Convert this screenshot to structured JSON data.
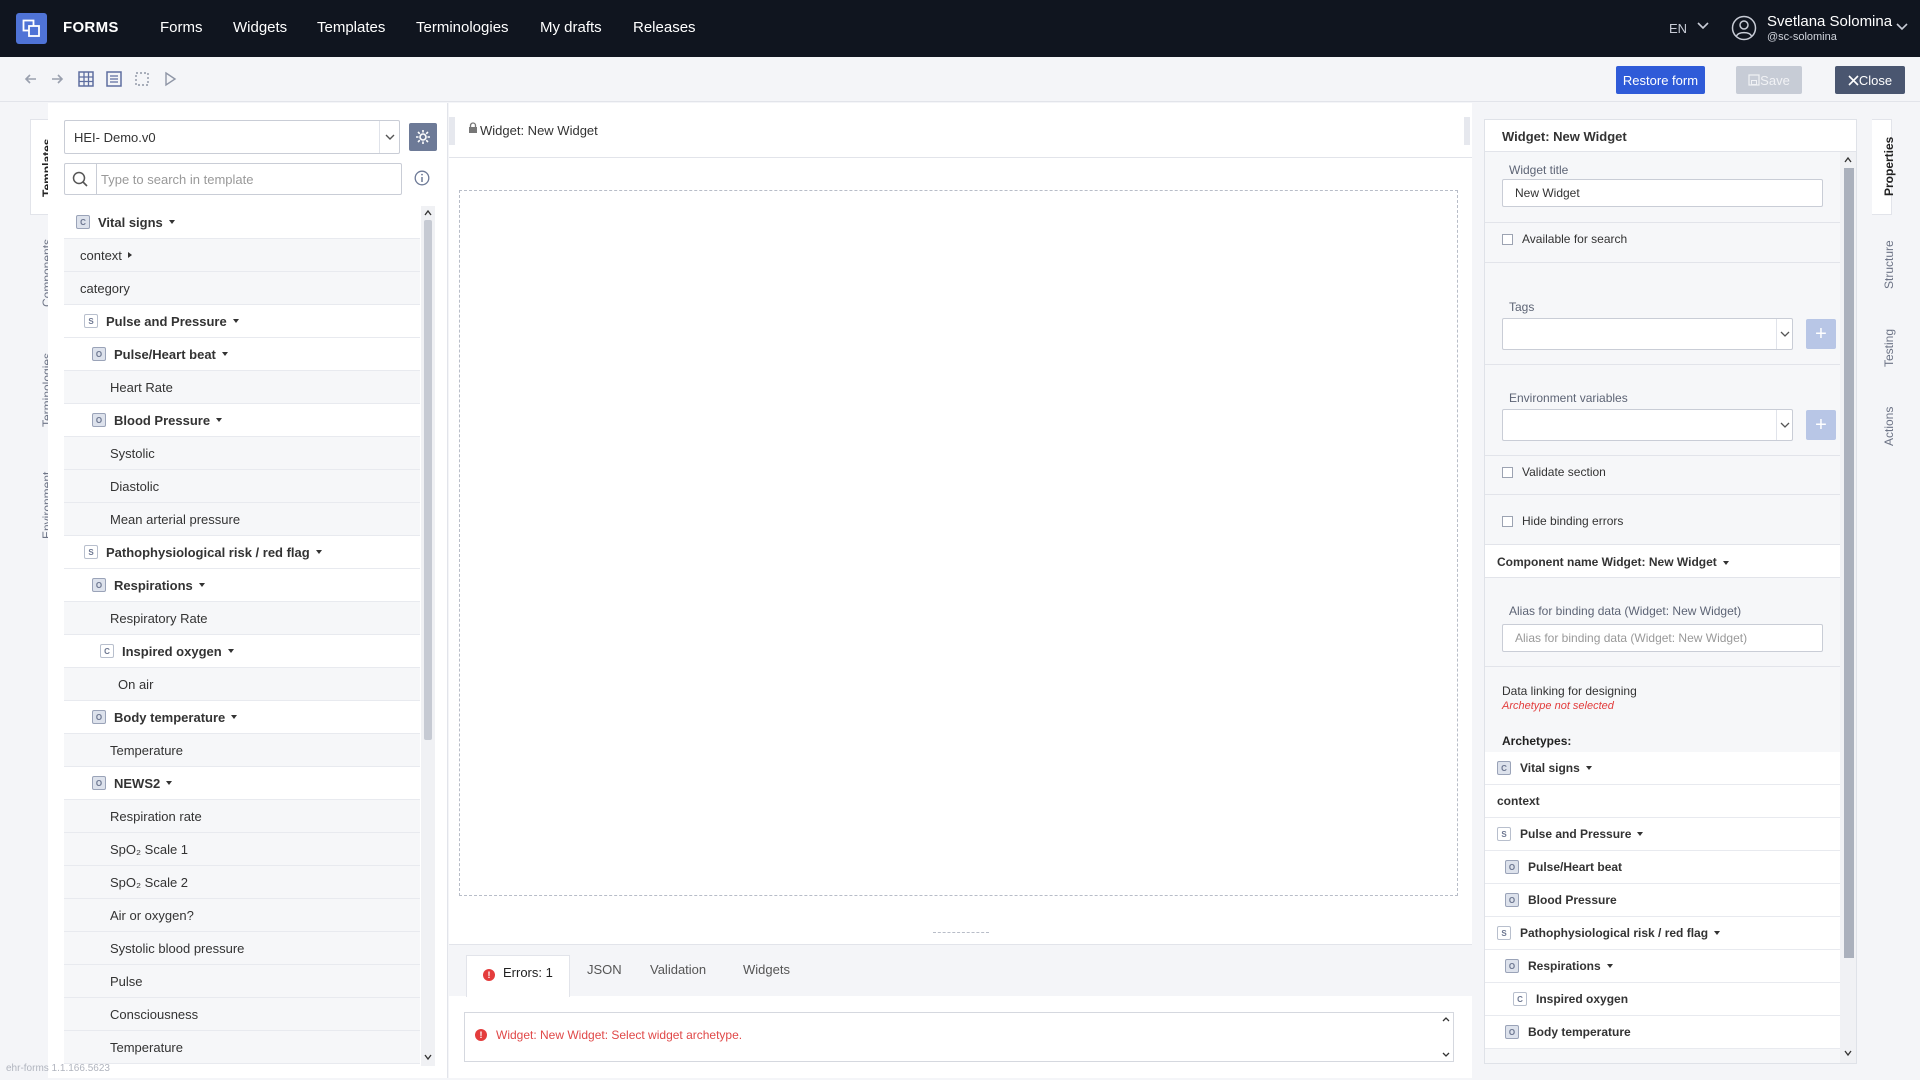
{
  "app": {
    "brand": "FORMS",
    "nav": [
      "Forms",
      "Widgets",
      "Templates",
      "Terminologies",
      "My drafts",
      "Releases"
    ],
    "language": "EN",
    "user_name": "Svetlana Solomina",
    "user_handle": "@sc-solomina",
    "version": "ehr-forms 1.1.166.5623"
  },
  "toolbar": {
    "restore_label": "Restore form",
    "save_label": "Save",
    "close_label": "Close"
  },
  "left_tabs": [
    "Templates",
    "Components",
    "Terminologies",
    "Environment"
  ],
  "template": {
    "selected": "HEI- Demo.v0",
    "search_placeholder": "Type to search in template"
  },
  "tree": [
    {
      "label": "Vital signs",
      "badge": "C",
      "bold": true,
      "caret": "down",
      "indent": 0
    },
    {
      "label": "context",
      "badge": "",
      "bold": false,
      "caret": "right",
      "indent": 0
    },
    {
      "label": "category",
      "badge": "",
      "bold": false,
      "caret": "",
      "indent": 0
    },
    {
      "label": "Pulse and Pressure",
      "badge": "S",
      "bold": true,
      "caret": "down",
      "indent": 1
    },
    {
      "label": "Pulse/Heart beat",
      "badge": "O",
      "bold": true,
      "caret": "down",
      "indent": 2
    },
    {
      "label": "Heart Rate",
      "badge": "",
      "bold": false,
      "caret": "",
      "indent": 2
    },
    {
      "label": "Blood Pressure",
      "badge": "O",
      "bold": true,
      "caret": "down",
      "indent": 2
    },
    {
      "label": "Systolic",
      "badge": "",
      "bold": false,
      "caret": "",
      "indent": 2
    },
    {
      "label": "Diastolic",
      "badge": "",
      "bold": false,
      "caret": "",
      "indent": 2
    },
    {
      "label": "Mean arterial pressure",
      "badge": "",
      "bold": false,
      "caret": "",
      "indent": 2
    },
    {
      "label": "Pathophysiological risk / red flag",
      "badge": "S",
      "bold": true,
      "caret": "down",
      "indent": 1
    },
    {
      "label": "Respirations",
      "badge": "O",
      "bold": true,
      "caret": "down",
      "indent": 2
    },
    {
      "label": "Respiratory Rate",
      "badge": "",
      "bold": false,
      "caret": "",
      "indent": 2
    },
    {
      "label": "Inspired oxygen",
      "badge": "C",
      "bold": true,
      "caret": "down",
      "indent": 3
    },
    {
      "label": "On air",
      "badge": "",
      "bold": false,
      "caret": "",
      "indent": 3
    },
    {
      "label": "Body temperature",
      "badge": "O",
      "bold": true,
      "caret": "down",
      "indent": 2
    },
    {
      "label": "Temperature",
      "badge": "",
      "bold": false,
      "caret": "",
      "indent": 2
    },
    {
      "label": "NEWS2",
      "badge": "O",
      "bold": true,
      "caret": "down",
      "indent": 2
    },
    {
      "label": "Respiration rate",
      "badge": "",
      "bold": false,
      "caret": "",
      "indent": 2
    },
    {
      "label": "SpO₂ Scale 1",
      "badge": "",
      "bold": false,
      "caret": "",
      "indent": 2
    },
    {
      "label": "SpO₂ Scale 2",
      "badge": "",
      "bold": false,
      "caret": "",
      "indent": 2
    },
    {
      "label": "Air or oxygen?",
      "badge": "",
      "bold": false,
      "caret": "",
      "indent": 2
    },
    {
      "label": "Systolic blood pressure",
      "badge": "",
      "bold": false,
      "caret": "",
      "indent": 2
    },
    {
      "label": "Pulse",
      "badge": "",
      "bold": false,
      "caret": "",
      "indent": 2
    },
    {
      "label": "Consciousness",
      "badge": "",
      "bold": false,
      "caret": "",
      "indent": 2
    },
    {
      "label": "Temperature",
      "badge": "",
      "bold": false,
      "caret": "",
      "indent": 2
    }
  ],
  "center": {
    "title": "Widget: New Widget",
    "bottom_tabs": [
      "Errors: 1",
      "JSON",
      "Validation",
      "Widgets"
    ],
    "error_message": "Widget: New Widget: Select widget archetype."
  },
  "properties": {
    "header": "Widget: New Widget",
    "widget_title_label": "Widget title",
    "widget_title_value": "New Widget",
    "available_for_search": "Available for search",
    "tags_label": "Tags",
    "env_label": "Environment variables",
    "validate_section": "Validate section",
    "hide_binding_errors": "Hide binding errors",
    "component_name": "Component name Widget: New Widget",
    "alias_label": "Alias for binding data (Widget: New Widget)",
    "alias_placeholder": "Alias for binding data  (Widget: New Widget)",
    "data_linking_label": "Data linking for designing",
    "archetype_warning": "Archetype not selected",
    "archetypes_label": "Archetypes:",
    "archetypes": [
      {
        "label": "Vital signs",
        "badge": "C",
        "caret": true,
        "indent": 0,
        "bold": true
      },
      {
        "label": "context",
        "badge": "",
        "caret": false,
        "indent": 0,
        "bold": true
      },
      {
        "label": "Pulse and Pressure",
        "badge": "S",
        "caret": true,
        "indent": 0,
        "bold": true
      },
      {
        "label": "Pulse/Heart beat",
        "badge": "O",
        "caret": false,
        "indent": 1,
        "bold": true
      },
      {
        "label": "Blood Pressure",
        "badge": "O",
        "caret": false,
        "indent": 1,
        "bold": true
      },
      {
        "label": "Pathophysiological risk / red flag",
        "badge": "S",
        "caret": true,
        "indent": 0,
        "bold": true
      },
      {
        "label": "Respirations",
        "badge": "O",
        "caret": true,
        "indent": 1,
        "bold": true
      },
      {
        "label": "Inspired oxygen",
        "badge": "C",
        "caret": false,
        "indent": 2,
        "bold": true
      },
      {
        "label": "Body temperature",
        "badge": "O",
        "caret": false,
        "indent": 1,
        "bold": true
      }
    ]
  },
  "right_tabs": [
    "Properties",
    "Structure",
    "Testing",
    "Actions"
  ],
  "colors": {
    "nav_bg": "#10151f",
    "primary": "#2f5bd8",
    "error": "#e23c3c"
  }
}
